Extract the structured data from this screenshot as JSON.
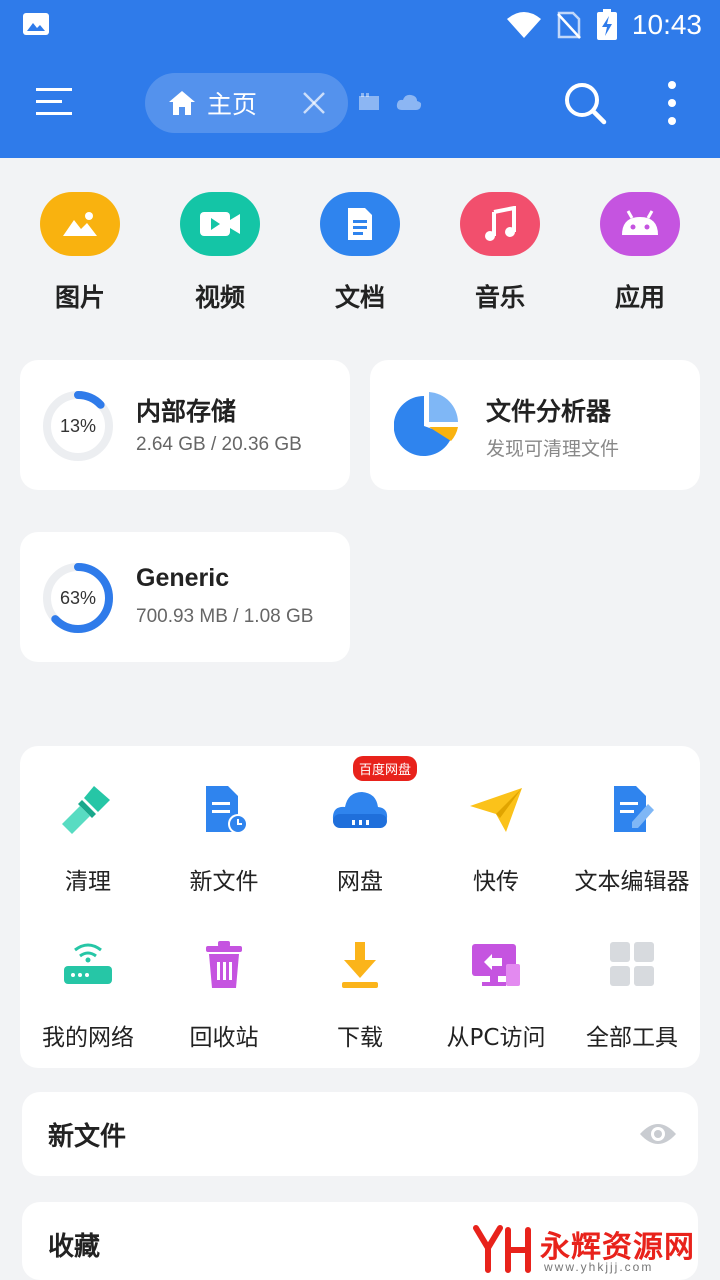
{
  "status_bar": {
    "time": "10:43"
  },
  "toolbar": {
    "tab_label": "主页"
  },
  "categories": [
    {
      "label": "图片",
      "icon": "image-icon",
      "color": "#f9b20f"
    },
    {
      "label": "视频",
      "icon": "video-icon",
      "color": "#14c5a6"
    },
    {
      "label": "文档",
      "icon": "document-icon",
      "color": "#2f84ee"
    },
    {
      "label": "音乐",
      "icon": "music-icon",
      "color": "#f24f6d"
    },
    {
      "label": "应用",
      "icon": "android-icon",
      "color": "#c554e0"
    }
  ],
  "storage": {
    "internal": {
      "title": "内部存储",
      "percent_label": "13%",
      "percent": 13,
      "size": "2.64 GB / 20.36 GB"
    },
    "analyzer": {
      "title": "文件分析器",
      "subtitle": "发现可清理文件"
    },
    "generic": {
      "title": "Generic",
      "percent_label": "63%",
      "percent": 63,
      "size": "700.93 MB / 1.08 GB"
    }
  },
  "tools": {
    "badge": "百度网盘",
    "items": [
      {
        "label": "清理",
        "icon": "brush-icon"
      },
      {
        "label": "新文件",
        "icon": "new-file-icon"
      },
      {
        "label": "网盘",
        "icon": "cloud-drive-icon"
      },
      {
        "label": "快传",
        "icon": "paper-plane-icon"
      },
      {
        "label": "文本编辑器",
        "icon": "text-editor-icon"
      },
      {
        "label": "我的网络",
        "icon": "router-icon"
      },
      {
        "label": "回收站",
        "icon": "trash-icon"
      },
      {
        "label": "下载",
        "icon": "download-icon"
      },
      {
        "label": "从PC访问",
        "icon": "pc-access-icon"
      },
      {
        "label": "全部工具",
        "icon": "grid-icon"
      }
    ]
  },
  "sections": {
    "new_files": "新文件",
    "favorites": "收藏"
  },
  "watermark": {
    "main": "永辉资源网",
    "sub": "www.yhkjjj.com"
  },
  "colors": {
    "accent": "#2f7bea",
    "ring": "#2f7bea",
    "badge": "#e8221b"
  }
}
